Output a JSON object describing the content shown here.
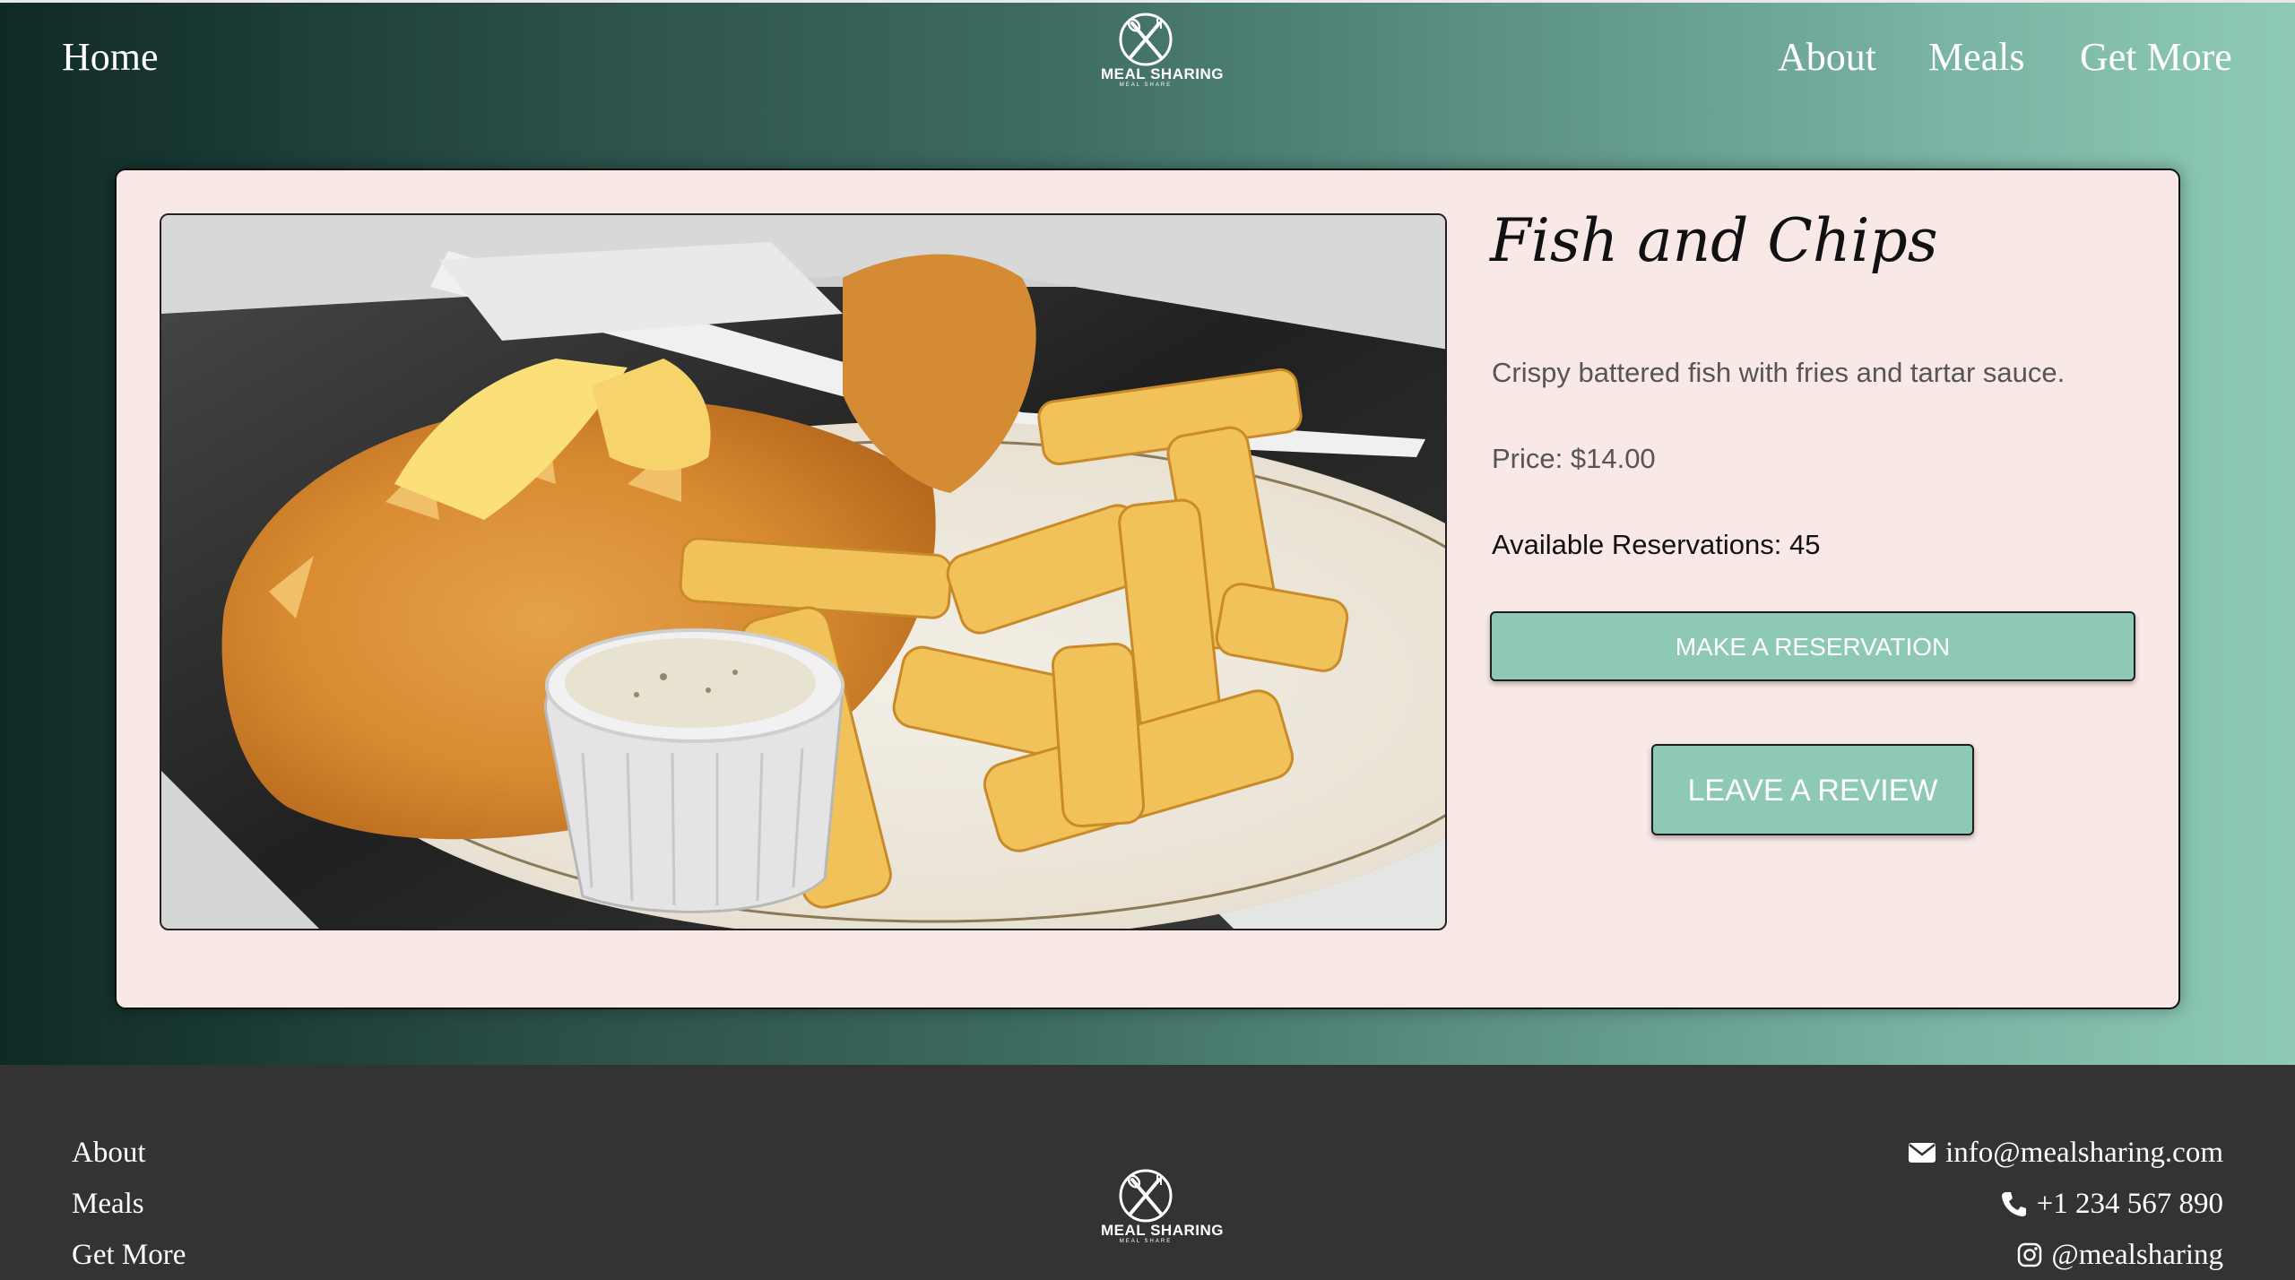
{
  "header": {
    "home_label": "Home",
    "nav": {
      "about": "About",
      "meals": "Meals",
      "get_more": "Get More"
    },
    "logo": {
      "text": "MEAL SHARING",
      "subtext": "MEAL  SHARE"
    }
  },
  "meal": {
    "title": "Fish and Chips",
    "description": "Crispy battered fish with fries and tartar sauce.",
    "price": "Price: $14.00",
    "available": "Available Reservations: 45",
    "reserve_label": "Make a Reservation",
    "review_label": "Leave a Review",
    "image_icon": "fish-and-chips-photo"
  },
  "footer": {
    "links": {
      "about": "About",
      "meals": "Meals",
      "get_more": "Get More"
    },
    "logo": {
      "text": "MEAL SHARING",
      "subtext": "MEAL  SHARE"
    },
    "contact": {
      "email": "info@mealsharing.com",
      "phone": "+1 234 567 890",
      "instagram": "@mealsharing",
      "email_icon": "envelope-icon",
      "phone_icon": "phone-icon",
      "instagram_icon": "instagram-icon"
    }
  },
  "colors": {
    "accent": "#8ec9b6",
    "card_bg": "#f8e8e6",
    "footer_bg": "#333333",
    "gradient_start": "#0f2a26",
    "gradient_end": "#8ecab7"
  }
}
